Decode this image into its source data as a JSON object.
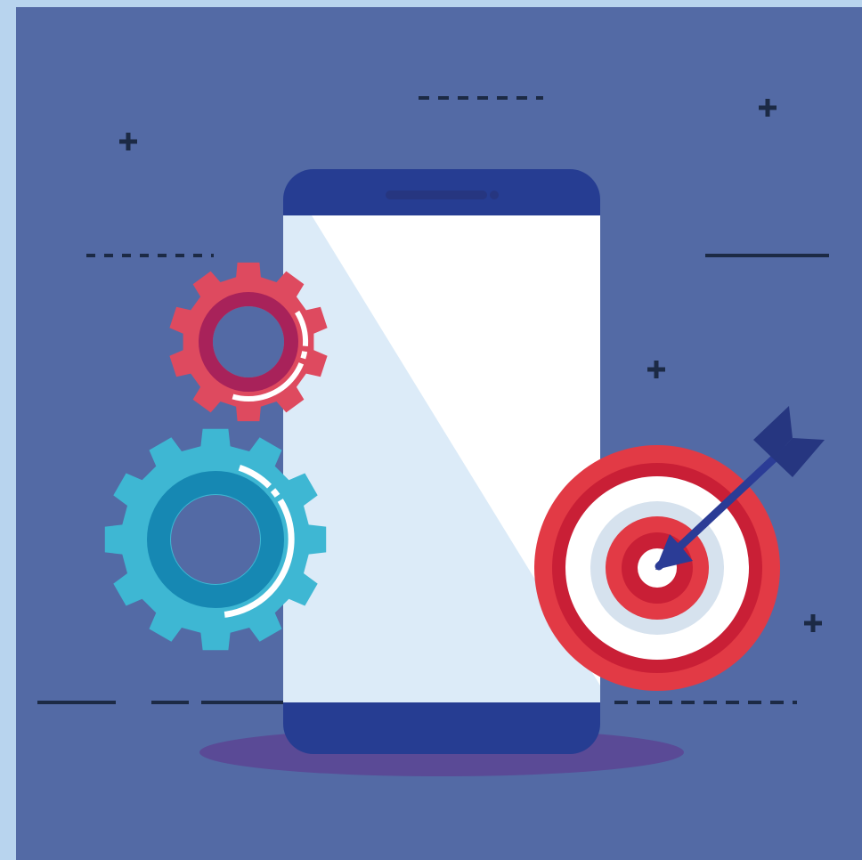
{
  "colors": {
    "outer_frame": "#b8d4ee",
    "background": "#536aa5",
    "phone_body": "#263d92",
    "phone_screen": "#ffffff",
    "phone_screen_shade": "#dcebf8",
    "shadow": "#5a4a96",
    "gear_small": "#de4a5f",
    "gear_small_ring": "#a8225a",
    "gear_large": "#3eb7d3",
    "gear_large_ring": "#1688b3",
    "target_red": "#e23a45",
    "target_mid": "#c91f36",
    "target_white": "#ffffff",
    "target_pale": "#d6e2ee",
    "arrow": "#2b3c96",
    "arrow_fletching": "#263680",
    "lines": "#1c2a45"
  },
  "illustration": {
    "subject": "smartphone-with-gears-and-target",
    "icons": [
      "smartphone-icon",
      "gear-icon",
      "gear-icon",
      "target-icon",
      "arrow-icon",
      "plus-icon"
    ]
  }
}
